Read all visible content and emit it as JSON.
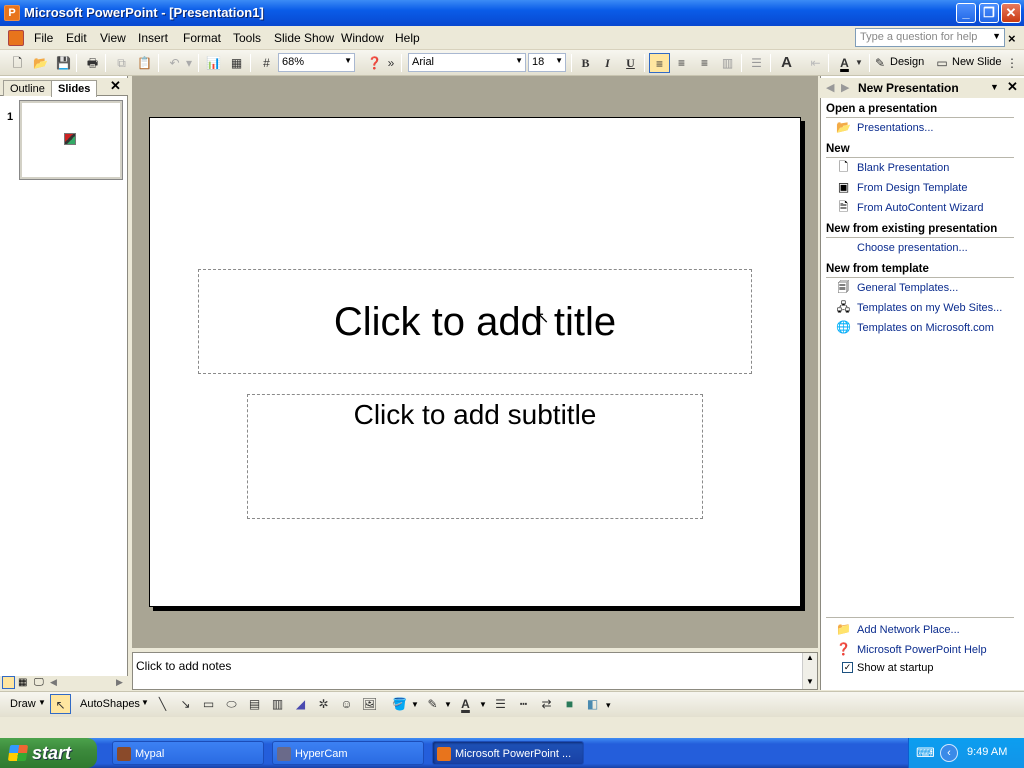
{
  "window": {
    "title": "Microsoft PowerPoint - [Presentation1]",
    "app_icon": "powerpoint-icon"
  },
  "menu": {
    "items": [
      "File",
      "Edit",
      "View",
      "Insert",
      "Format",
      "Tools",
      "Slide Show",
      "Window",
      "Help"
    ],
    "help_placeholder": "Type a question for help"
  },
  "toolbar": {
    "zoom": "68%",
    "font": "Arial",
    "font_size": "18",
    "bold": "B",
    "italic": "I",
    "underline": "U",
    "design_label": "Design",
    "new_slide_label": "New Slide"
  },
  "left_pane": {
    "tabs": [
      "Outline",
      "Slides"
    ],
    "selected_tab": "Slides",
    "slide_number": "1"
  },
  "slide": {
    "title_placeholder": "Click to add title",
    "subtitle_placeholder": "Click to add subtitle"
  },
  "notes": {
    "placeholder": "Click to add notes"
  },
  "task_pane": {
    "title": "New Presentation",
    "sections": [
      {
        "heading": "Open a presentation",
        "links": [
          {
            "label": "Presentations...",
            "icon": "folder-open-icon"
          }
        ]
      },
      {
        "heading": "New",
        "links": [
          {
            "label": "Blank Presentation",
            "icon": "blank-page-icon"
          },
          {
            "label": "From Design Template",
            "icon": "design-template-icon"
          },
          {
            "label": "From AutoContent Wizard",
            "icon": "wizard-icon"
          }
        ]
      },
      {
        "heading": "New from existing presentation",
        "links": [
          {
            "label": "Choose presentation...",
            "icon": "none"
          }
        ]
      },
      {
        "heading": "New from template",
        "links": [
          {
            "label": "General Templates...",
            "icon": "templates-icon"
          },
          {
            "label": "Templates on my Web Sites...",
            "icon": "web-templates-icon"
          },
          {
            "label": "Templates on Microsoft.com",
            "icon": "globe-icon"
          }
        ]
      }
    ],
    "footer": {
      "network_place": "Add Network Place...",
      "help": "Microsoft PowerPoint Help",
      "show_at_startup": "Show at startup",
      "show_at_startup_checked": true
    }
  },
  "draw_toolbar": {
    "draw_label": "Draw",
    "autoshapes_label": "AutoShapes"
  },
  "taskbar": {
    "start_label": "start",
    "tasks": [
      {
        "label": "Mypal",
        "active": false
      },
      {
        "label": "HyperCam",
        "active": false
      },
      {
        "label": "Microsoft PowerPoint ...",
        "active": true
      }
    ],
    "clock": "9:49 AM"
  },
  "colors": {
    "titlebar": "#0a5ce8",
    "taskbar": "#245edb",
    "start": "#3c8a3c",
    "link": "#0b2c8e",
    "slide_area": "#a9a594"
  }
}
